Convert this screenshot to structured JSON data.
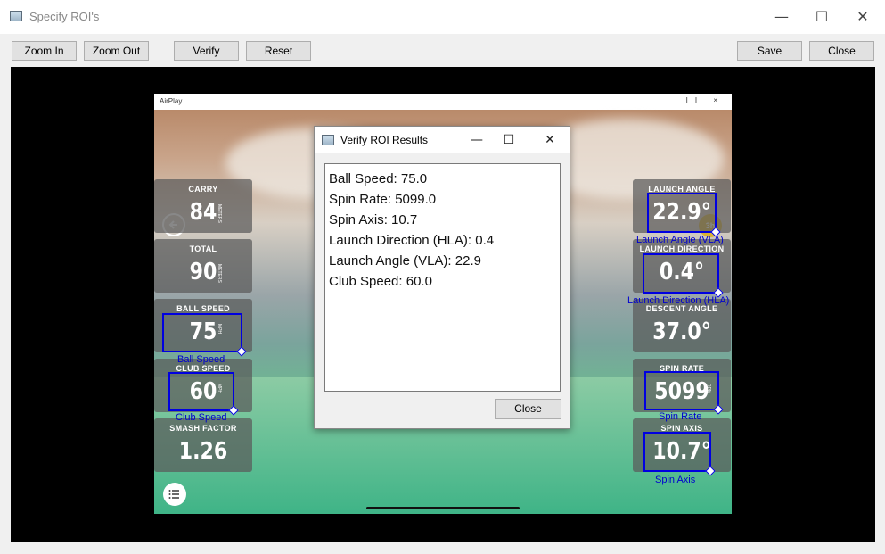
{
  "window": {
    "title": "Specify ROI's",
    "minimize": "—",
    "maximize": "☐",
    "close": "✕"
  },
  "toolbar": {
    "zoom_in": "Zoom In",
    "zoom_out": "Zoom Out",
    "verify": "Verify",
    "reset": "Reset",
    "save": "Save",
    "close": "Close"
  },
  "game": {
    "title": "AirPlay",
    "controls": "II ×",
    "badge": "3h",
    "left_tiles": [
      {
        "label": "CARRY",
        "value": "84",
        "unit": "METERS"
      },
      {
        "label": "TOTAL",
        "value": "90",
        "unit": "METERS"
      },
      {
        "label": "BALL SPEED",
        "value": "75",
        "unit": "MPH"
      },
      {
        "label": "CLUB SPEED",
        "value": "60",
        "unit": "MPH"
      },
      {
        "label": "SMASH FACTOR",
        "value": "1.26",
        "unit": ""
      }
    ],
    "right_tiles": [
      {
        "label": "LAUNCH ANGLE",
        "value": "22.9°",
        "unit": ""
      },
      {
        "label": "LAUNCH DIRECTION",
        "value": "0.4°",
        "unit": ""
      },
      {
        "label": "DESCENT ANGLE",
        "value": "37.0°",
        "unit": ""
      },
      {
        "label": "SPIN RATE",
        "value": "5099",
        "unit": "RPM"
      },
      {
        "label": "SPIN AXIS",
        "value": "10.7°",
        "unit": ""
      }
    ]
  },
  "roi_labels": {
    "ball_speed": "Ball Speed",
    "club_speed": "Club Speed",
    "launch_angle": "Launch Angle (VLA)",
    "launch_direction": "Launch Direction (HLA)",
    "spin_rate": "Spin Rate",
    "spin_axis": "Spin Axis"
  },
  "dialog": {
    "title": "Verify ROI Results",
    "minimize": "—",
    "maximize": "☐",
    "close": "✕",
    "results": [
      "Ball Speed: 75.0",
      "Spin Rate: 5099.0",
      "Spin Axis: 10.7",
      "Launch Direction (HLA): 0.4",
      "Launch Angle (VLA): 22.9",
      "Club Speed: 60.0"
    ],
    "close_button": "Close"
  },
  "colors": {
    "roi_border": "#0000e0",
    "badge": "#d9b233"
  }
}
